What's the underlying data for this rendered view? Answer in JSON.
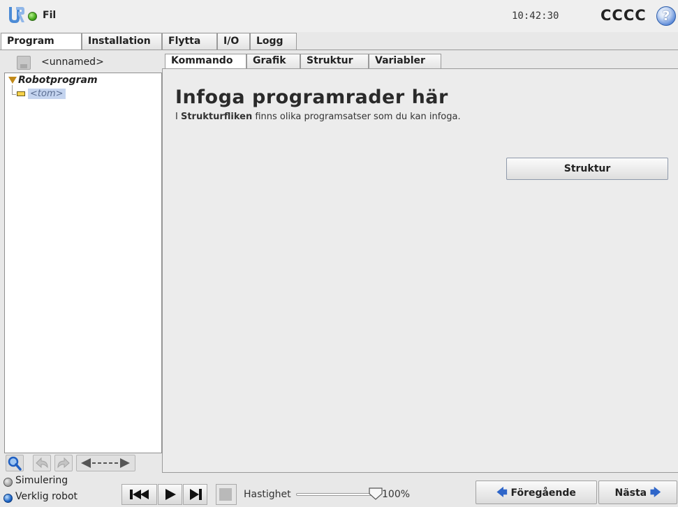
{
  "header": {
    "file_menu": "Fil",
    "time": "10:42:30",
    "robot_name": "CCCC",
    "help_glyph": "?"
  },
  "main_tabs": [
    {
      "label": "Program",
      "active": true
    },
    {
      "label": "Installation",
      "active": false
    },
    {
      "label": "Flytta",
      "active": false
    },
    {
      "label": "I/O",
      "active": false
    },
    {
      "label": "Logg",
      "active": false
    }
  ],
  "left_pane": {
    "program_name": "<unnamed>",
    "tree": {
      "root": "Robotprogram",
      "child": "<tom>"
    },
    "toolbar": {
      "search_icon": "magnifier-icon",
      "undo_icon": "undo-icon",
      "redo_icon": "redo-icon",
      "move_icon": "move-arrows-icon"
    }
  },
  "sub_tabs": [
    {
      "label": "Kommando",
      "active": true
    },
    {
      "label": "Grafik",
      "active": false
    },
    {
      "label": "Struktur",
      "active": false
    },
    {
      "label": "Variabler",
      "active": false
    }
  ],
  "content": {
    "title": "Infoga programrader här",
    "desc_prefix": "I ",
    "desc_bold": "Strukturfliken",
    "desc_suffix": " finns olika programsatser som du kan infoga.",
    "structure_button": "Struktur"
  },
  "bottom": {
    "sim_label": "Simulering",
    "real_label": "Verklig robot",
    "speed_label": "Hastighet",
    "speed_value": "100%",
    "speed_fraction": 1.0,
    "prev_button": "Föregående",
    "next_button": "Nästa"
  },
  "colors": {
    "accent_blue": "#2f66c9",
    "led_green": "#4cb022",
    "tree_selection": "#c4d4ef"
  }
}
